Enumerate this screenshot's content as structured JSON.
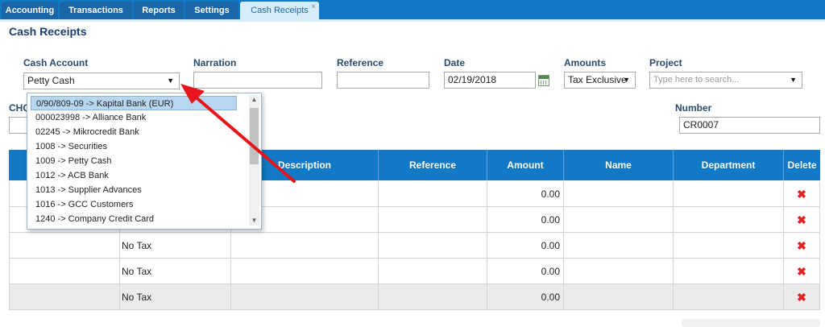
{
  "tabs": [
    {
      "label": "Accounting"
    },
    {
      "label": "Transactions"
    },
    {
      "label": "Reports"
    },
    {
      "label": "Settings"
    },
    {
      "label": "Cash Receipts",
      "close": "×"
    }
  ],
  "page": {
    "title": "Cash Receipts"
  },
  "form": {
    "cash_account": {
      "label": "Cash Account",
      "value": "Petty Cash"
    },
    "narration": {
      "label": "Narration",
      "value": ""
    },
    "reference": {
      "label": "Reference",
      "value": ""
    },
    "date": {
      "label": "Date",
      "value": "02/19/2018"
    },
    "amounts": {
      "label": "Amounts",
      "value": "Tax Exclusive"
    },
    "project": {
      "label": "Project",
      "placeholder": "Type here to search..."
    },
    "cheque_label": "CHQ",
    "number": {
      "label": "Number",
      "value": "CR0007"
    }
  },
  "dropdown_items": [
    "0/90/809-09 -> Kapital Bank (EUR)",
    "000023998 -> Alliance Bank",
    "02245 -> Mikrocredit Bank",
    "1008 -> Securities",
    "1009 -> Petty Cash",
    "1012 -> ACB Bank",
    "1013 -> Supplier Advances",
    "1016 -> GCC Customers",
    "1240 -> Company Credit Card"
  ],
  "grid": {
    "headers": {
      "description": "Description",
      "reference": "Reference",
      "amount": "Amount",
      "name": "Name",
      "department": "Department",
      "delete": "Delete"
    },
    "rows": [
      {
        "tax": "",
        "amount": "0.00"
      },
      {
        "tax": "",
        "amount": "0.00"
      },
      {
        "tax": "No Tax",
        "amount": "0.00"
      },
      {
        "tax": "No Tax",
        "amount": "0.00"
      },
      {
        "tax": "No Tax",
        "amount": "0.00"
      }
    ],
    "delete_glyph": "✖"
  },
  "colors": {
    "accent": "#1179c5",
    "annotation_arrow": "#e8141b",
    "delete": "#e0231e"
  }
}
